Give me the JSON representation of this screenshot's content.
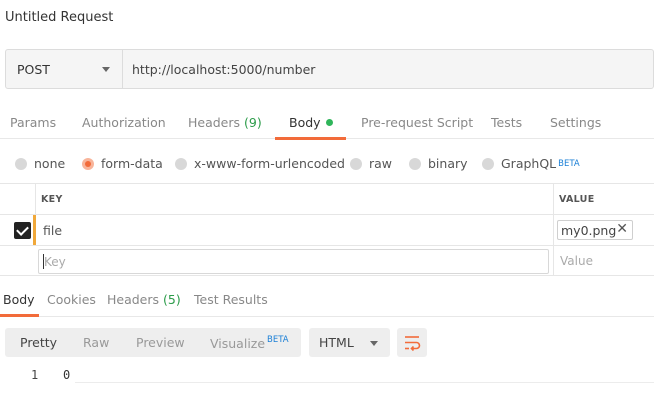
{
  "request": {
    "title": "Untitled Request",
    "method": "POST",
    "url": "http://localhost:5000/number"
  },
  "request_tabs": {
    "params": "Params",
    "authorization": "Authorization",
    "headers": "Headers",
    "headers_count": "(9)",
    "body": "Body",
    "prerequest": "Pre-request Script",
    "tests": "Tests",
    "settings": "Settings"
  },
  "body_types": {
    "none": "none",
    "form_data": "form-data",
    "urlencoded": "x-www-form-urlencoded",
    "raw": "raw",
    "binary": "binary",
    "graphql": "GraphQL",
    "beta": "BETA",
    "selected": "form-data"
  },
  "form_table": {
    "key_header": "KEY",
    "value_header": "VALUE",
    "rows": [
      {
        "checked": true,
        "key": "file",
        "value": "my0.png"
      }
    ],
    "new_key_placeholder": "Key",
    "new_value_placeholder": "Value"
  },
  "response_tabs": {
    "body": "Body",
    "cookies": "Cookies",
    "headers": "Headers",
    "headers_count": "(5)",
    "test_results": "Test Results"
  },
  "response_toolbar": {
    "pretty": "Pretty",
    "raw": "Raw",
    "preview": "Preview",
    "visualize": "Visualize",
    "beta": "BETA",
    "language": "HTML"
  },
  "response_body": {
    "lines": [
      {
        "number": "1",
        "text": "0"
      }
    ]
  },
  "colors": {
    "accent": "#f26b3a",
    "success": "#2fb55a",
    "beta_blue": "#1a7fd6"
  }
}
